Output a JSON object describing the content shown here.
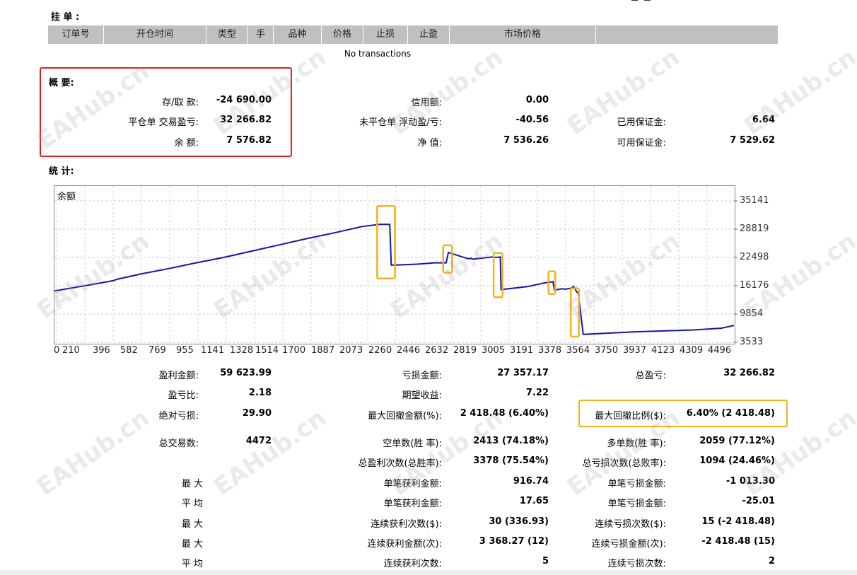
{
  "orders": {
    "title": "挂 单 :",
    "headers": [
      "订单号",
      "开仓时间",
      "类型",
      "手",
      "品种",
      "价格",
      "止损",
      "止盈",
      "市场价格",
      ""
    ],
    "empty_text": "No transactions"
  },
  "summary": {
    "title": "概 要:",
    "rows": [
      {
        "l1": "存/取 款:",
        "v1": "-24 690.00",
        "l2": "信用额:",
        "v2": "0.00",
        "l3": "",
        "v3": ""
      },
      {
        "l1": "平仓单 交易盈亏:",
        "v1": "32 266.82",
        "l2": "未平仓单 浮动盈/亏:",
        "v2": "-40.56",
        "l3": "已用保证金:",
        "v3": "6.64"
      },
      {
        "l1": "余 额:",
        "v1": "7 576.82",
        "l2": "净 值:",
        "v2": "7 536.26",
        "l3": "可用保证金:",
        "v3": "7 529.62"
      }
    ]
  },
  "stats_title": "统 计:",
  "chart_data": {
    "type": "line",
    "title": "余额",
    "y_ticks": [
      "35141",
      "28819",
      "22498",
      "16176",
      "9854",
      "3533"
    ],
    "x_ticks": [
      "0",
      "210",
      "396",
      "582",
      "769",
      "955",
      "1141",
      "1328",
      "1514",
      "1700",
      "1887",
      "2073",
      "2260",
      "2446",
      "2632",
      "2819",
      "3005",
      "3191",
      "3378",
      "3564",
      "3750",
      "3937",
      "4123",
      "4309",
      "4496"
    ],
    "ylim": [
      3533,
      35141
    ],
    "xlim": [
      0,
      4580
    ],
    "series": [
      {
        "color": "#1515a8",
        "x": [
          0,
          210,
          396,
          420,
          582,
          769,
          955,
          1141,
          1328,
          1514,
          1700,
          1887,
          2073,
          2190,
          2260,
          2270,
          2300,
          2446,
          2560,
          2640,
          2655,
          2790,
          2810,
          2820,
          2950,
          2980,
          3005,
          3010,
          3191,
          3300,
          3360,
          3370,
          3420,
          3440,
          3480,
          3500,
          3520,
          3530,
          3564,
          3750,
          3937,
          4123,
          4309,
          4496,
          4580
        ],
        "y": [
          15000,
          16200,
          17300,
          17600,
          18800,
          20000,
          21300,
          22500,
          23900,
          25300,
          26700,
          28000,
          29400,
          29900,
          29900,
          20800,
          20800,
          21000,
          21300,
          21300,
          23600,
          22200,
          22300,
          22100,
          22600,
          22500,
          22600,
          15300,
          16000,
          16800,
          17100,
          15200,
          15500,
          15400,
          15600,
          16000,
          14800,
          14600,
          5300,
          5600,
          5900,
          6100,
          6300,
          6700,
          7300
        ]
      }
    ],
    "highlight_color": "#f2b31b",
    "highlights": [
      {
        "x": [
          2175,
          2295
        ],
        "y": [
          17800,
          34000
        ]
      },
      {
        "x": [
          2620,
          2680
        ],
        "y": [
          19100,
          25200
        ]
      },
      {
        "x": [
          2960,
          3020
        ],
        "y": [
          13600,
          23500
        ]
      },
      {
        "x": [
          3330,
          3375
        ],
        "y": [
          14300,
          19400
        ]
      },
      {
        "x": [
          3480,
          3535
        ],
        "y": [
          4800,
          15600
        ]
      }
    ]
  },
  "stats": {
    "col1": [
      {
        "label": "盈利金额:",
        "value": "59 623.99"
      },
      {
        "label": "盈亏比:",
        "value": "2.18"
      },
      {
        "label": "绝对亏损:",
        "value": "29.90"
      },
      {
        "label": "总交易数:",
        "value": "4472"
      },
      {
        "label": "最 大",
        "value": ""
      },
      {
        "label": "平 均",
        "value": ""
      },
      {
        "label": "最 大",
        "value": ""
      },
      {
        "label": "最 大",
        "value": ""
      },
      {
        "label": "平 均",
        "value": ""
      }
    ],
    "col2": [
      {
        "label": "亏损金额:",
        "value": "27 357.17"
      },
      {
        "label": "期望收益:",
        "value": "7.22"
      },
      {
        "label": "最大回撤金额(%):",
        "value": "2 418.48 (6.40%)"
      },
      {
        "label": "空单数(胜 率):",
        "value": "2413 (74.18%)"
      },
      {
        "label": "总盈利次数(总胜率):",
        "value": "3378 (75.54%)"
      },
      {
        "label": "单笔获利金额:",
        "value": "916.74"
      },
      {
        "label": "单笔获利金额:",
        "value": "17.65"
      },
      {
        "label": "连续获利次数($):",
        "value": "30 (336.93)"
      },
      {
        "label": "连续获利金额(次):",
        "value": "3 368.27 (12)"
      },
      {
        "label": "连续获利次数:",
        "value": "5"
      }
    ],
    "col3": [
      {
        "label": "总盈亏:",
        "value": "32 266.82"
      },
      {
        "label": "最大回撤比例($):",
        "value": "6.40% (2 418.48)"
      },
      {
        "label": "多单数(胜 率):",
        "value": "2059 (77.12%)"
      },
      {
        "label": "总亏损次数(总败率):",
        "value": "1094 (24.46%)"
      },
      {
        "label": "单笔亏损金额:",
        "value": "-1 013.30"
      },
      {
        "label": "单笔亏损金额:",
        "value": "-25.01"
      },
      {
        "label": "连续亏损次数($):",
        "value": "15 (-2 418.48)"
      },
      {
        "label": "连续亏损金额(次):",
        "value": "-2 418.48 (15)"
      },
      {
        "label": "连续亏损次数:",
        "value": "2"
      }
    ]
  },
  "watermark": "EAHub.cn"
}
